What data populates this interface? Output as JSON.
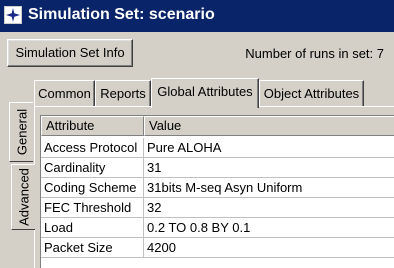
{
  "window": {
    "title": "Simulation Set: scenario",
    "icon": "star-app-icon"
  },
  "toolbar": {
    "info_button": "Simulation Set Info",
    "runs_label": "Number of runs in set:  7"
  },
  "tabs": [
    {
      "label": "Common",
      "active": false
    },
    {
      "label": "Reports",
      "active": false
    },
    {
      "label": "Global Attributes",
      "active": true
    },
    {
      "label": "Object Attributes",
      "active": false
    }
  ],
  "side_tabs": [
    {
      "label": "General",
      "active": true
    },
    {
      "label": "Advanced",
      "active": false
    }
  ],
  "table": {
    "columns": [
      "Attribute",
      "Value"
    ],
    "rows": [
      {
        "attribute": "Access Protocol",
        "value": "Pure ALOHA"
      },
      {
        "attribute": "Cardinality",
        "value": "31"
      },
      {
        "attribute": "Coding Scheme",
        "value": "31bits M-seq Asyn Uniform"
      },
      {
        "attribute": "FEC Threshold",
        "value": "32"
      },
      {
        "attribute": "Load",
        "value": "0.2 TO 0.8 BY 0.1"
      },
      {
        "attribute": "Packet Size",
        "value": "4200"
      }
    ]
  },
  "colors": {
    "titlebar": "#0a246a",
    "face": "#d4d0c8"
  }
}
